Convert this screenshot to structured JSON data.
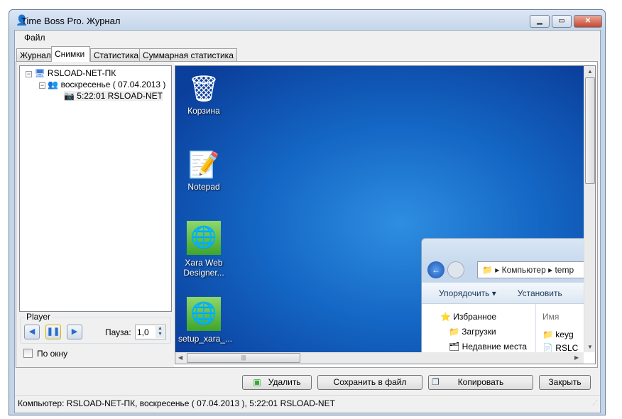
{
  "window": {
    "title": "Time Boss Pro. Журнал",
    "controls": [
      "minimize",
      "maximize",
      "close"
    ]
  },
  "menu": {
    "items": [
      "Файл"
    ]
  },
  "tabs": [
    {
      "label": "Журнал"
    },
    {
      "label": "Снимки",
      "active": true
    },
    {
      "label": "Статистика"
    },
    {
      "label": "Суммарная статистика"
    }
  ],
  "tree": {
    "computer": "RSLOAD-NET-ПК",
    "day": "воскресенье  ( 07.04.2013 )",
    "snapshot": "5:22:01  RSLOAD-NET"
  },
  "player": {
    "label": "Player",
    "pause_label": "Пауза:",
    "pause_value": "1,0",
    "fit_label": "По окну",
    "fit_checked": false
  },
  "screenshot": {
    "desktop_icons": [
      {
        "label": "Корзина",
        "icon": "recycle-bin-icon"
      },
      {
        "label": "Notepad",
        "icon": "notepad-icon"
      },
      {
        "label": "Xara Web Designer...",
        "icon": "globe-icon"
      },
      {
        "label": "setup_xara_...",
        "icon": "globe-icon"
      }
    ],
    "explorer": {
      "path": [
        "Компьютер",
        "temp"
      ],
      "toolbar": [
        "Упорядочить ▾",
        "Установить"
      ],
      "nav": [
        "Избранное",
        "Загрузки",
        "Недавние места"
      ],
      "column": "Имя",
      "files": [
        "keyg",
        "RSLC"
      ]
    }
  },
  "buttons": {
    "delete": "Удалить",
    "save": "Сохранить в файл",
    "copy": "Копировать",
    "close": "Закрыть"
  },
  "status": "Компьютер: RSLOAD-NET-ПК, воскресенье  ( 07.04.2013 ), 5:22:01  RSLOAD-NET"
}
